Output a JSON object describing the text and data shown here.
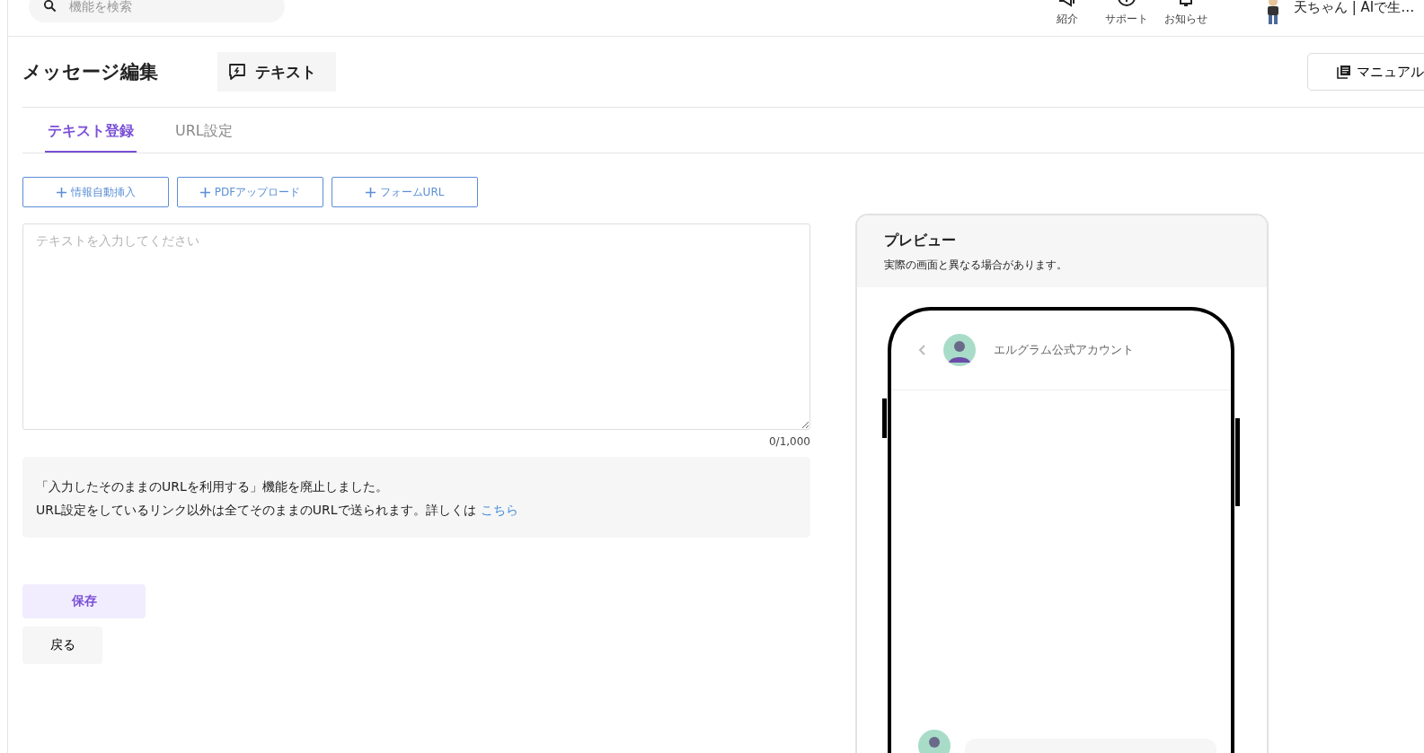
{
  "header": {
    "search": {
      "placeholder": "機能を検索"
    },
    "nav": [
      {
        "label": "紹介",
        "kind": "megaphone"
      },
      {
        "label": "サポート",
        "kind": "help"
      },
      {
        "label": "お知らせ",
        "kind": "bell"
      }
    ],
    "user_name": "天ちゃん | AIで生…"
  },
  "title": "メッセージ編集",
  "type_chip": "テキスト",
  "manual_button": "マニュアル",
  "tabs": [
    {
      "label": "テキスト登録",
      "selected": true
    },
    {
      "label": "URL設定",
      "selected": false
    }
  ],
  "insert_buttons": [
    "情報自動挿入",
    "PDFアップロード",
    "フォームURL"
  ],
  "editor": {
    "placeholder": "テキストを入力してください",
    "counter": "0/1,000"
  },
  "notice": {
    "line_1": "「入力したそのままのURLを利用する」機能を廃止しました。",
    "line_2": "URL設定をしているリンク以外は全てそのままのURLで送られます。詳しくは",
    "link": "こちら"
  },
  "save_button": "保存",
  "back_button": "戻る",
  "preview": {
    "title": "プレビュー",
    "subtitle": "実際の画面と異なる場合があります。",
    "account_name": "エルグラム公式アカウント"
  }
}
